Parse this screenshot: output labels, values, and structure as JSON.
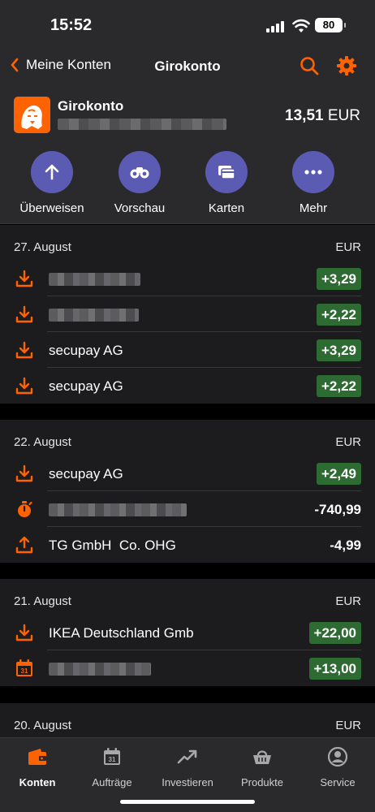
{
  "status_bar": {
    "time": "15:52",
    "battery": "80"
  },
  "nav": {
    "back_label": "Meine Konten",
    "title": "Girokonto"
  },
  "account": {
    "name": "Girokonto",
    "balance_amount": "13,51",
    "balance_currency": "EUR"
  },
  "actions": [
    {
      "label": "Überweisen",
      "icon": "arrow-up-icon"
    },
    {
      "label": "Vorschau",
      "icon": "binoculars-icon"
    },
    {
      "label": "Karten",
      "icon": "cards-icon"
    },
    {
      "label": "Mehr",
      "icon": "more-dots-icon"
    }
  ],
  "groups": [
    {
      "date": "27. August",
      "currency": "EUR",
      "transactions": [
        {
          "name": "",
          "amount": "+3,29",
          "icon": "incoming-icon"
        },
        {
          "name": "",
          "amount": "+2,22",
          "icon": "incoming-icon"
        },
        {
          "name": "secupay AG",
          "amount": "+3,29",
          "icon": "incoming-icon"
        },
        {
          "name": "secupay AG",
          "amount": "+2,22",
          "icon": "incoming-icon"
        }
      ]
    },
    {
      "date": "22. August",
      "currency": "EUR",
      "transactions": [
        {
          "name": "secupay AG",
          "amount": "+2,49",
          "icon": "incoming-icon"
        },
        {
          "name": "",
          "amount": "-740,99",
          "icon": "stopwatch-icon"
        },
        {
          "name": "TG GmbH  Co. OHG",
          "amount": "-4,99",
          "icon": "outgoing-icon"
        }
      ]
    },
    {
      "date": "21. August",
      "currency": "EUR",
      "transactions": [
        {
          "name": "IKEA Deutschland Gmb",
          "amount": "+22,00",
          "icon": "incoming-icon"
        },
        {
          "name": "",
          "amount": "+13,00",
          "icon": "calendar-icon"
        }
      ]
    },
    {
      "date": "20. August",
      "currency": "EUR",
      "transactions": []
    }
  ],
  "tabs": [
    {
      "label": "Konten",
      "icon": "wallet-icon",
      "active": true
    },
    {
      "label": "Aufträge",
      "icon": "calendar-icon",
      "active": false
    },
    {
      "label": "Investieren",
      "icon": "trend-icon",
      "active": false
    },
    {
      "label": "Produkte",
      "icon": "basket-icon",
      "active": false
    },
    {
      "label": "Service",
      "icon": "person-icon",
      "active": false
    }
  ],
  "colors": {
    "accent": "#ff6200",
    "action": "#5b5bb3",
    "positive_bg": "#2e6b32",
    "surface": "#2a2a2c",
    "list_bg": "#1c1c1e"
  }
}
